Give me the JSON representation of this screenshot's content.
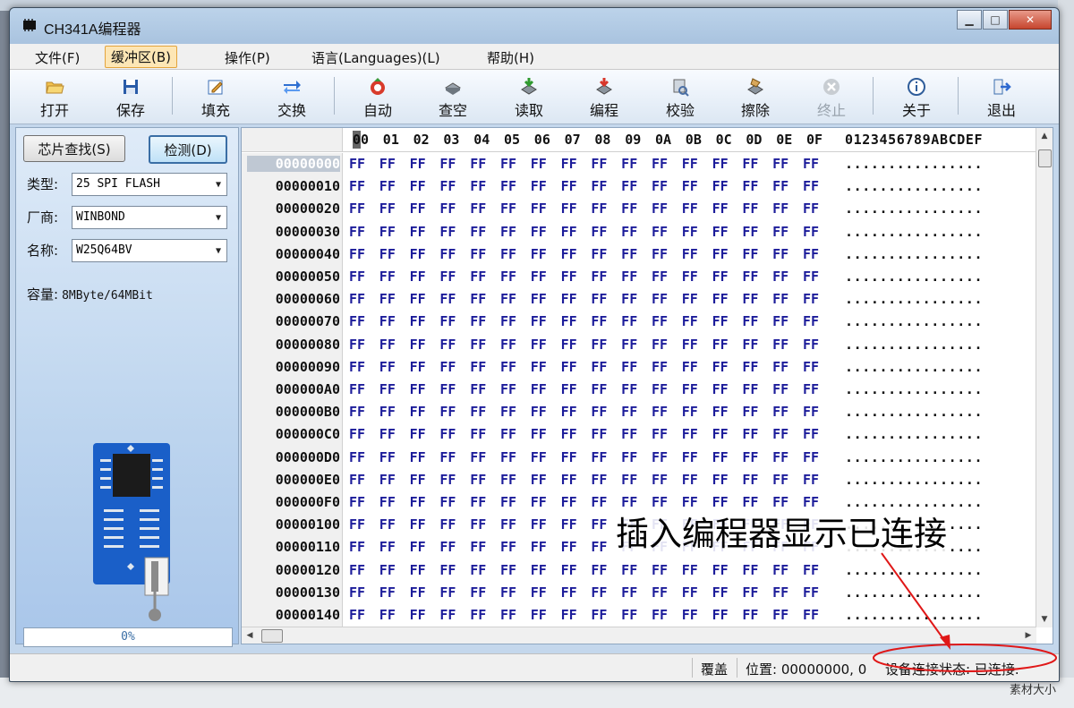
{
  "window": {
    "title": "CH341A编程器"
  },
  "menu": [
    "文件(F)",
    "缓冲区(B)",
    "操作(P)",
    "语言(Languages)(L)",
    "帮助(H)"
  ],
  "toolbar": [
    {
      "label": "打开",
      "icon": "folder-open-icon"
    },
    {
      "label": "保存",
      "icon": "floppy-disk-icon"
    },
    {
      "label": "填充",
      "icon": "edit-icon"
    },
    {
      "label": "交换",
      "icon": "swap-arrows-icon"
    },
    {
      "label": "自动",
      "icon": "auto-run-icon"
    },
    {
      "label": "查空",
      "icon": "blank-check-icon"
    },
    {
      "label": "读取",
      "icon": "read-chip-icon"
    },
    {
      "label": "编程",
      "icon": "program-chip-icon"
    },
    {
      "label": "校验",
      "icon": "verify-icon"
    },
    {
      "label": "擦除",
      "icon": "erase-icon"
    },
    {
      "label": "终止",
      "icon": "stop-icon"
    },
    {
      "label": "关于",
      "icon": "info-icon"
    },
    {
      "label": "退出",
      "icon": "exit-icon"
    }
  ],
  "left_panel": {
    "find_button": "芯片查找(S)",
    "detect_button": "检测(D)",
    "type_label": "类型:",
    "type_value": "25 SPI FLASH",
    "maker_label": "厂商:",
    "maker_value": "WINBOND",
    "name_label": "名称:",
    "name_value": "W25Q64BV",
    "capacity_label": "容量:",
    "capacity_value": "8MByte/64MBit",
    "progress": "0%"
  },
  "hex": {
    "columns": [
      "00",
      "01",
      "02",
      "03",
      "04",
      "05",
      "06",
      "07",
      "08",
      "09",
      "0A",
      "0B",
      "0C",
      "0D",
      "0E",
      "0F"
    ],
    "ascii_header": "0123456789ABCDEF",
    "rows": [
      {
        "addr": "00000000",
        "bytes": "FF FF FF FF FF FF FF FF FF FF FF FF FF FF FF FF",
        "ascii": "................"
      },
      {
        "addr": "00000010",
        "bytes": "FF FF FF FF FF FF FF FF FF FF FF FF FF FF FF FF",
        "ascii": "................"
      },
      {
        "addr": "00000020",
        "bytes": "FF FF FF FF FF FF FF FF FF FF FF FF FF FF FF FF",
        "ascii": "................"
      },
      {
        "addr": "00000030",
        "bytes": "FF FF FF FF FF FF FF FF FF FF FF FF FF FF FF FF",
        "ascii": "................"
      },
      {
        "addr": "00000040",
        "bytes": "FF FF FF FF FF FF FF FF FF FF FF FF FF FF FF FF",
        "ascii": "................"
      },
      {
        "addr": "00000050",
        "bytes": "FF FF FF FF FF FF FF FF FF FF FF FF FF FF FF FF",
        "ascii": "................"
      },
      {
        "addr": "00000060",
        "bytes": "FF FF FF FF FF FF FF FF FF FF FF FF FF FF FF FF",
        "ascii": "................"
      },
      {
        "addr": "00000070",
        "bytes": "FF FF FF FF FF FF FF FF FF FF FF FF FF FF FF FF",
        "ascii": "................"
      },
      {
        "addr": "00000080",
        "bytes": "FF FF FF FF FF FF FF FF FF FF FF FF FF FF FF FF",
        "ascii": "................"
      },
      {
        "addr": "00000090",
        "bytes": "FF FF FF FF FF FF FF FF FF FF FF FF FF FF FF FF",
        "ascii": "................"
      },
      {
        "addr": "000000A0",
        "bytes": "FF FF FF FF FF FF FF FF FF FF FF FF FF FF FF FF",
        "ascii": "................"
      },
      {
        "addr": "000000B0",
        "bytes": "FF FF FF FF FF FF FF FF FF FF FF FF FF FF FF FF",
        "ascii": "................"
      },
      {
        "addr": "000000C0",
        "bytes": "FF FF FF FF FF FF FF FF FF FF FF FF FF FF FF FF",
        "ascii": "................"
      },
      {
        "addr": "000000D0",
        "bytes": "FF FF FF FF FF FF FF FF FF FF FF FF FF FF FF FF",
        "ascii": "................"
      },
      {
        "addr": "000000E0",
        "bytes": "FF FF FF FF FF FF FF FF FF FF FF FF FF FF FF FF",
        "ascii": "................"
      },
      {
        "addr": "000000F0",
        "bytes": "FF FF FF FF FF FF FF FF FF FF FF FF FF FF FF FF",
        "ascii": "................"
      },
      {
        "addr": "00000100",
        "bytes": "FF FF FF FF FF FF FF FF FF FF FF FF FF FF FF FF",
        "ascii": "................"
      },
      {
        "addr": "00000110",
        "bytes": "FF FF FF FF FF FF FF FF FF FF FF FF FF FF FF FF",
        "ascii": "................"
      },
      {
        "addr": "00000120",
        "bytes": "FF FF FF FF FF FF FF FF FF FF FF FF FF FF FF FF",
        "ascii": "................"
      },
      {
        "addr": "00000130",
        "bytes": "FF FF FF FF FF FF FF FF FF FF FF FF FF FF FF FF",
        "ascii": "................"
      },
      {
        "addr": "00000140",
        "bytes": "FF FF FF FF FF FF FF FF FF FF FF FF FF FF FF FF",
        "ascii": "................"
      }
    ]
  },
  "status": {
    "mode": "覆盖",
    "position": "位置: 00000000, 0",
    "connection": "设备连接状态: 已连接."
  },
  "annotation": "插入编程器显示已连接",
  "desktop_bottom_label": "素材大小",
  "colors": {
    "hex_bytes": "#1c1c9a",
    "annotation_arrow": "#e01818",
    "menu_active": "#fde6b5"
  }
}
